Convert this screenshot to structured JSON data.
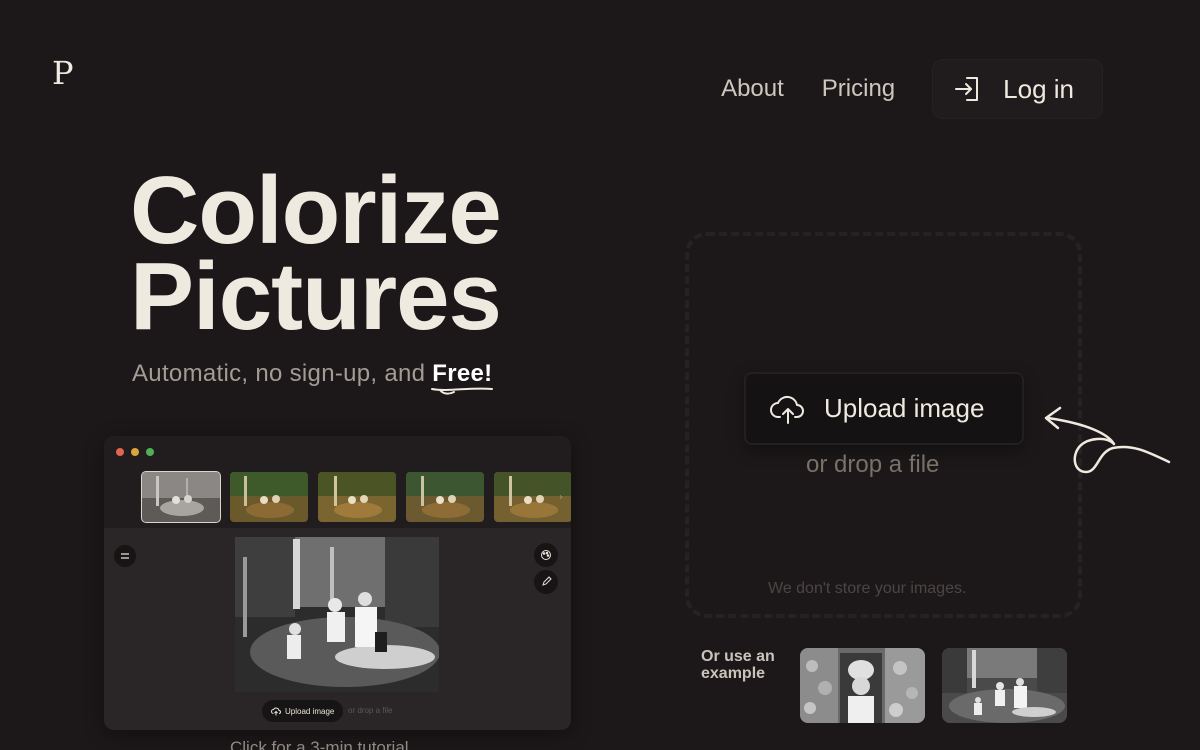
{
  "logo": "P",
  "nav": {
    "about": "About",
    "pricing": "Pricing",
    "login": "Log in"
  },
  "hero": {
    "title_line1": "Colorize",
    "title_line2": "Pictures",
    "subtitle_prefix": "Automatic, no sign-up, and ",
    "subtitle_emphasis": "Free!"
  },
  "preview": {
    "upload_label": "Upload image",
    "drop_label": "or drop a file",
    "caption": "Click for a 3-min tutorial"
  },
  "dropzone": {
    "upload_label": "Upload image",
    "drop_label": "or drop a file",
    "privacy_note": "We don't store your images."
  },
  "examples": {
    "label": "Or use an example"
  },
  "colors": {
    "background": "#1c1819",
    "text": "#efeae0",
    "muted": "#787169"
  },
  "icons": [
    "login-icon",
    "cloud-upload-icon",
    "palette-icon",
    "pencil-icon",
    "menu-icon"
  ]
}
